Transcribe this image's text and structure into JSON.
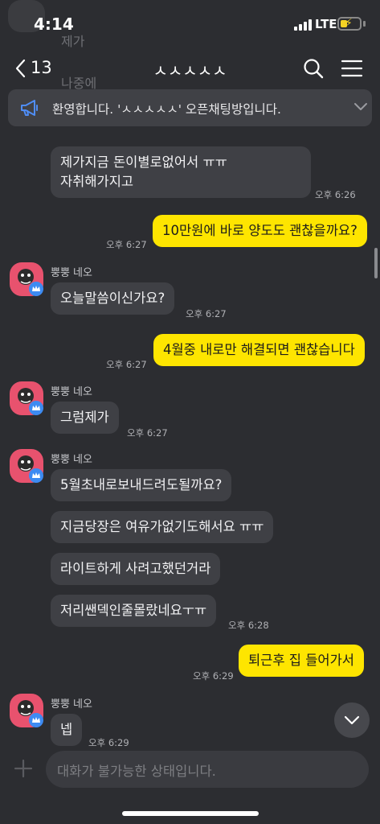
{
  "status_bar": {
    "time": "4:14",
    "network": "LTE"
  },
  "header": {
    "back_count": "13",
    "title": "ㅅㅅㅅㅅㅅ"
  },
  "behind_header": {
    "text_1": "제가",
    "text_2": "나중에"
  },
  "notice": {
    "text": "환영합니다. 'ㅅㅅㅅㅅㅅ' 오픈채팅방입니다."
  },
  "messages": [
    {
      "id": "m1",
      "direction": "in",
      "text": "제가지금 돈이별로없어서 ㅠㅠ 자취해가지고",
      "time": "오후 6:26"
    },
    {
      "id": "m2",
      "direction": "out",
      "text": "10만원에 바로 양도도 괜찮을까요?",
      "time": "오후 6:27"
    },
    {
      "id": "m3",
      "direction": "in",
      "sender": "뿡뿡 네오",
      "text": "오늘말씀이신가요?",
      "time": "오후 6:27"
    },
    {
      "id": "m4",
      "direction": "out",
      "text": "4월중 내로만 해결되면 괜찮습니다",
      "time": "오후 6:27"
    },
    {
      "id": "m5",
      "direction": "in",
      "sender": "뿡뿡 네오",
      "text": "그럼제가",
      "time": "오후 6:27"
    },
    {
      "id": "m6",
      "direction": "in",
      "sender": "뿡뿡 네오",
      "text": "5월초내로보내드려도될까요?"
    },
    {
      "id": "m7",
      "direction": "in",
      "text": "지금당장은 여유가없기도해서요 ㅠㅠ"
    },
    {
      "id": "m8",
      "direction": "in",
      "text": "라이트하게 사려고했던거라"
    },
    {
      "id": "m9",
      "direction": "in",
      "text": "저리쌘덱인줄몰랐네요ㅜㅠ",
      "time": "오후 6:28"
    },
    {
      "id": "m10",
      "direction": "out",
      "text": "퇴근후 집 들어가서",
      "time": "오후 6:29"
    },
    {
      "id": "m11",
      "direction": "in",
      "sender": "뿡뿡 네오",
      "text": "넵",
      "time": "오후 6:29"
    }
  ],
  "input": {
    "placeholder": "대화가 불가능한 상태입니다."
  },
  "icons": {
    "back": "chevron-left-icon",
    "search": "search-icon",
    "menu": "hamburger-menu-icon",
    "notice": "megaphone-icon",
    "expand": "chevron-down-icon",
    "plus": "plus-icon",
    "scroll_down": "chevron-down-icon"
  },
  "colors": {
    "background": "#2c2d31",
    "incoming_bubble": "#3f4045",
    "outgoing_bubble": "#fee500",
    "avatar_pink": "#e8526e",
    "badge_blue": "#3d8bf2",
    "battery": "#f5d324"
  }
}
